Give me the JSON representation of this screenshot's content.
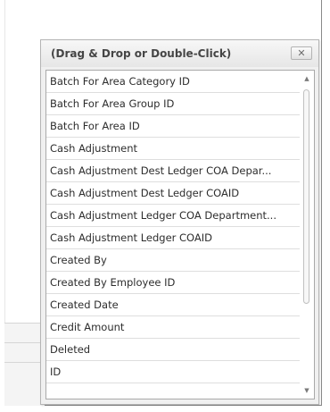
{
  "customization_window": {
    "title": "(Drag & Drop or Double-Click)",
    "close_glyph": "✕",
    "close_icon": "close-icon",
    "fields": [
      "Batch For Area Category ID",
      "Batch For Area Group ID",
      "Batch For Area ID",
      "Cash Adjustment",
      "Cash Adjustment Dest Ledger COA Depar...",
      "Cash Adjustment Dest Ledger COAID",
      "Cash Adjustment Ledger COA Department...",
      "Cash Adjustment Ledger COAID",
      "Created By",
      "Created By Employee ID",
      "Created Date",
      "Credit Amount",
      "Deleted",
      "ID"
    ],
    "scroll_up_glyph": "▲",
    "scroll_down_glyph": "▼",
    "scroll_up_icon": "scroll-up-arrow-icon",
    "scroll_down_icon": "scroll-down-arrow-icon"
  },
  "colors": {
    "header_text": "#454545",
    "item_text": "#2d2d2d",
    "border": "#a9a9a9"
  }
}
